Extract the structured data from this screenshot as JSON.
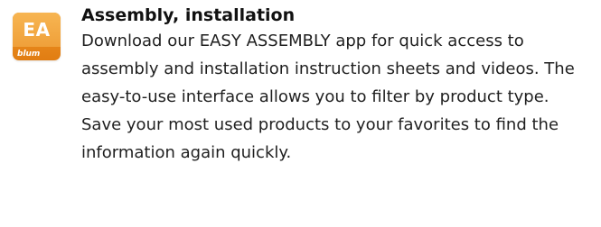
{
  "app": {
    "icon_name": "easy-assembly-app-icon",
    "icon_text": "EA",
    "icon_brand": "blum",
    "accent_color": "#e8891d"
  },
  "section": {
    "title": "Assembly, installation",
    "description": "Download our EASY ASSEMBLY app for quick access to assembly and installation instruction sheets and videos. The easy-to-use interface allows you to filter by product type. Save your most used products to your favorites to find the information again quickly."
  }
}
